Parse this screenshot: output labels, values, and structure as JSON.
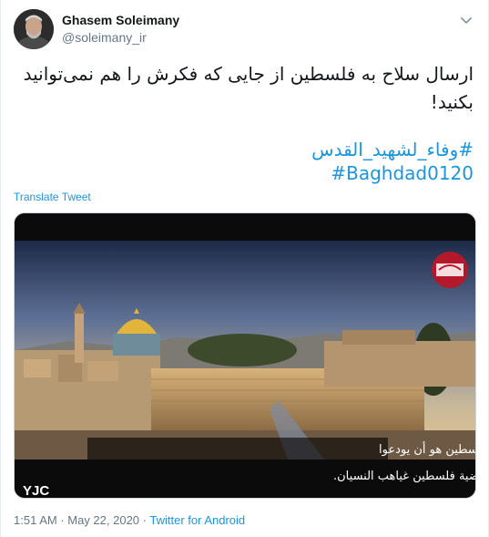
{
  "author": {
    "name": "Ghasem Soleimany",
    "handle": "@soleimany_ir"
  },
  "tweet": {
    "text": "ارسال سلاح به فلسطین از جایی که فکرش را هم نمی‌توانید بکنید!",
    "hashtags": [
      "#وفاء_لشهید_القدس",
      "#Baghdad0120"
    ]
  },
  "translate_label": "Translate Tweet",
  "media": {
    "subtitle_line1": "كان مخطط الأمريكيين بشأن فلسطين هو أن يودعوا",
    "subtitle_line2": "قضية فلسطين غياهب النسيان.",
    "channel_logo": "channel-logo-icon"
  },
  "watermark": "YJC",
  "meta": {
    "time": "1:51 AM",
    "sep1": " · ",
    "date": "May 22, 2020",
    "sep2": " · ",
    "source": "Twitter for Android"
  },
  "colors": {
    "link": "#1b95e0",
    "secondary_text": "#657786",
    "primary_text": "#14171a"
  }
}
